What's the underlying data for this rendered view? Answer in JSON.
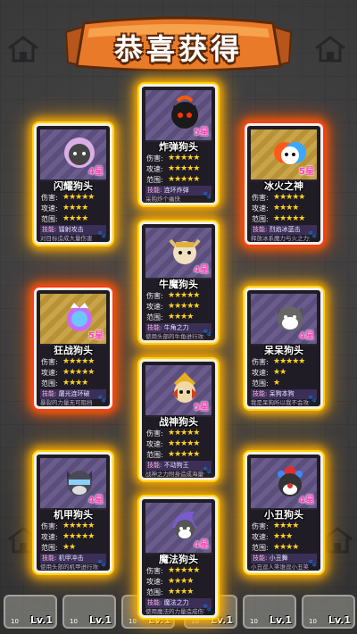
{
  "title": "恭喜获得",
  "stat_labels": {
    "attack": "伤害:",
    "speed": "攻速:",
    "range": "范围:"
  },
  "skill_label": "技能:",
  "cards": [
    {
      "name": "炸弹狗头",
      "rank": "5星",
      "skill": "连环炸弹",
      "desc": "采购炸个痛快",
      "attack": "★★★★★",
      "speed": "★★★★★",
      "range": "★★★★★"
    },
    {
      "name": "闪耀狗头",
      "rank": "4星",
      "skill": "镭射攻击",
      "desc": "对目标造成大量伤害",
      "attack": "★★★★★",
      "speed": "★★★★",
      "range": "★★★★"
    },
    {
      "name": "冰火之神",
      "rank": "5星",
      "skill": "烈焰冰蓝击",
      "desc": "释放冰系魔力与火之力造成海量伤害",
      "attack": "★★★★★",
      "speed": "★★★★",
      "range": "★★★★★"
    },
    {
      "name": "牛魔狗头",
      "rank": "4星",
      "skill": "牛角之力",
      "desc": "使用头部的牛角进行攻击",
      "attack": "★★★★★",
      "speed": "★★★★★",
      "range": "★★★★"
    },
    {
      "name": "狂战狗头",
      "rank": "5星",
      "skill": "屠光连环破",
      "desc": "暴裂的力量无可阻挡",
      "attack": "★★★★★",
      "speed": "★★★★★",
      "range": "★★★★"
    },
    {
      "name": "呆呆狗头",
      "rank": "4星",
      "skill": "呆狗本狗",
      "desc": "我是呆狗所以我不会攻击",
      "attack": "★★★★★",
      "speed": "★★",
      "range": "★"
    },
    {
      "name": "战神狗头",
      "rank": "5星",
      "skill": "不动狗王",
      "desc": "战神之力附身造成海量伤害",
      "attack": "★★★★★",
      "speed": "★★★★★",
      "range": "★★★★★"
    },
    {
      "name": "机甲狗头",
      "rank": "4星",
      "skill": "机甲冲击",
      "desc": "使用头部的机甲进行攻击",
      "attack": "★★★★★",
      "speed": "★★★★★",
      "range": "★★"
    },
    {
      "name": "小丑狗头",
      "rank": "4星",
      "skill": "小丑舞",
      "desc": "小丑逗人笑谁逗小丑笑",
      "attack": "★★★★",
      "speed": "★★★",
      "range": "★★★★"
    },
    {
      "name": "魔法狗头",
      "rank": "4星",
      "skill": "魔法之力",
      "desc": "使用魔法的力量造成伤害",
      "attack": "★★★★★",
      "speed": "★★★★",
      "range": "★★★★"
    }
  ],
  "bottom_slots": [
    {
      "coin": "10",
      "level": "Lv.1"
    },
    {
      "coin": "10",
      "level": "Lv.1"
    },
    {
      "coin": "10",
      "level": "Lv.1"
    },
    {
      "coin": "10",
      "level": "Lv.1"
    },
    {
      "coin": "10",
      "level": "Lv.1"
    },
    {
      "coin": "10",
      "level": "Lv.1"
    }
  ],
  "icons": [
    "house-icon",
    "paw-icon",
    "star-icon",
    "dog-head-icon"
  ],
  "colors": {
    "glow_yellow": "#ffd400",
    "glow_red": "#ff3b1f",
    "banner_orange": "#e87a2a",
    "star_yellow": "#ffd21f"
  }
}
